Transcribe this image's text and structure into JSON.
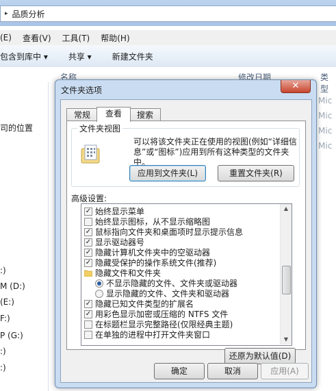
{
  "explorer": {
    "breadcrumb": "品质分析",
    "menu": [
      "(E)",
      "查看(V)",
      "工具(T)",
      "帮助(H)"
    ],
    "toolbar": [
      "包含到库中 ▾",
      "共享 ▾",
      "新建文件夹"
    ],
    "left_items": [
      "司的位置",
      ":)",
      "M (D:)",
      " (E:)",
      "F:)",
      "P (G:)",
      ":)",
      ":)"
    ],
    "columns": [
      "名称",
      "修改日期",
      "类型"
    ],
    "file_types": [
      "Mic",
      "Mic",
      "Mic",
      "Mic"
    ]
  },
  "dialog": {
    "title": "文件夹选项",
    "close_glyph": "✕",
    "tabs": [
      "常规",
      "查看",
      "搜索"
    ],
    "active_tab": "查看",
    "folder_view": {
      "label": "文件夹视图",
      "description": "可以将该文件夹正在使用的视图(例如“详细信息”或“图标”)应用到所有这种类型的文件夹中。",
      "apply_button": "应用到文件夹(L)",
      "reset_button": "重置文件夹(R)"
    },
    "advanced": {
      "label": "高级设置:",
      "items": [
        {
          "type": "check",
          "checked": true,
          "text": "始终显示菜单"
        },
        {
          "type": "check",
          "checked": false,
          "text": "始终显示图标，从不显示缩略图"
        },
        {
          "type": "check",
          "checked": true,
          "text": "鼠标指向文件夹和桌面项时显示提示信息"
        },
        {
          "type": "check",
          "checked": true,
          "text": "显示驱动器号"
        },
        {
          "type": "check",
          "checked": true,
          "text": "隐藏计算机文件夹中的空驱动器"
        },
        {
          "type": "check",
          "checked": true,
          "text": "隐藏受保护的操作系统文件(推荐)"
        },
        {
          "type": "folder",
          "text": "隐藏文件和文件夹"
        },
        {
          "type": "radio",
          "checked": true,
          "text": "不显示隐藏的文件、文件夹或驱动器"
        },
        {
          "type": "radio",
          "checked": false,
          "text": "显示隐藏的文件、文件夹和驱动器"
        },
        {
          "type": "check",
          "checked": true,
          "text": "隐藏已知文件类型的扩展名"
        },
        {
          "type": "check",
          "checked": true,
          "text": "用彩色显示加密或压缩的 NTFS 文件"
        },
        {
          "type": "check",
          "checked": false,
          "text": "在标题栏显示完整路径(仅限经典主题)"
        },
        {
          "type": "check",
          "checked": false,
          "text": "在单独的进程中打开文件夹窗口"
        }
      ],
      "restore_button": "还原为默认值(D)"
    },
    "ok_button": "确定",
    "cancel_button": "取消",
    "apply_button": "应用(A)"
  },
  "colors": {
    "accent": "#3c7fb1",
    "frame": "#c9dcf1",
    "close": "#c7462e"
  }
}
